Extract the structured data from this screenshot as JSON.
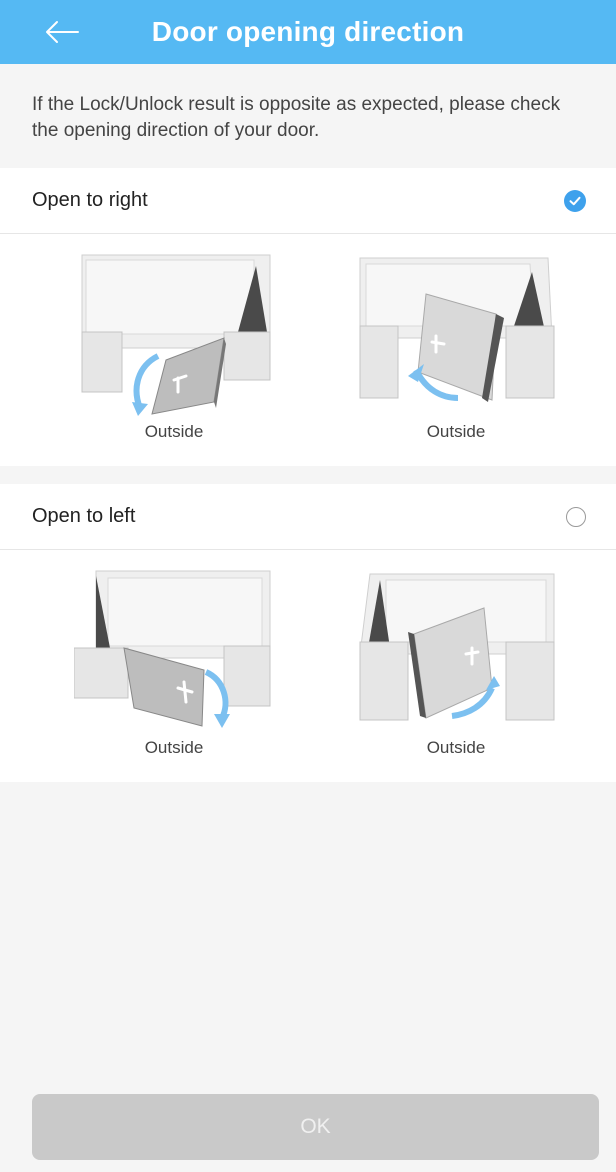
{
  "header": {
    "title": "Door opening direction",
    "back_icon": "arrow-left-icon"
  },
  "hint": "If the Lock/Unlock result is opposite as expected, please check the opening direction of your door.",
  "options": [
    {
      "label": "Open to right",
      "selected": true,
      "illustrations": [
        {
          "caption": "Outside",
          "icon": "door-outward-right-illustration"
        },
        {
          "caption": "Outside",
          "icon": "door-inward-right-illustration"
        }
      ]
    },
    {
      "label": "Open to left",
      "selected": false,
      "illustrations": [
        {
          "caption": "Outside",
          "icon": "door-outward-left-illustration"
        },
        {
          "caption": "Outside",
          "icon": "door-inward-left-illustration"
        }
      ]
    }
  ],
  "ok_button": "OK",
  "colors": {
    "header_bg": "#55b9f3",
    "selected_radio": "#3ea1ec",
    "arrow": "#7cc0f0",
    "button_disabled": "#c9c9c9"
  }
}
